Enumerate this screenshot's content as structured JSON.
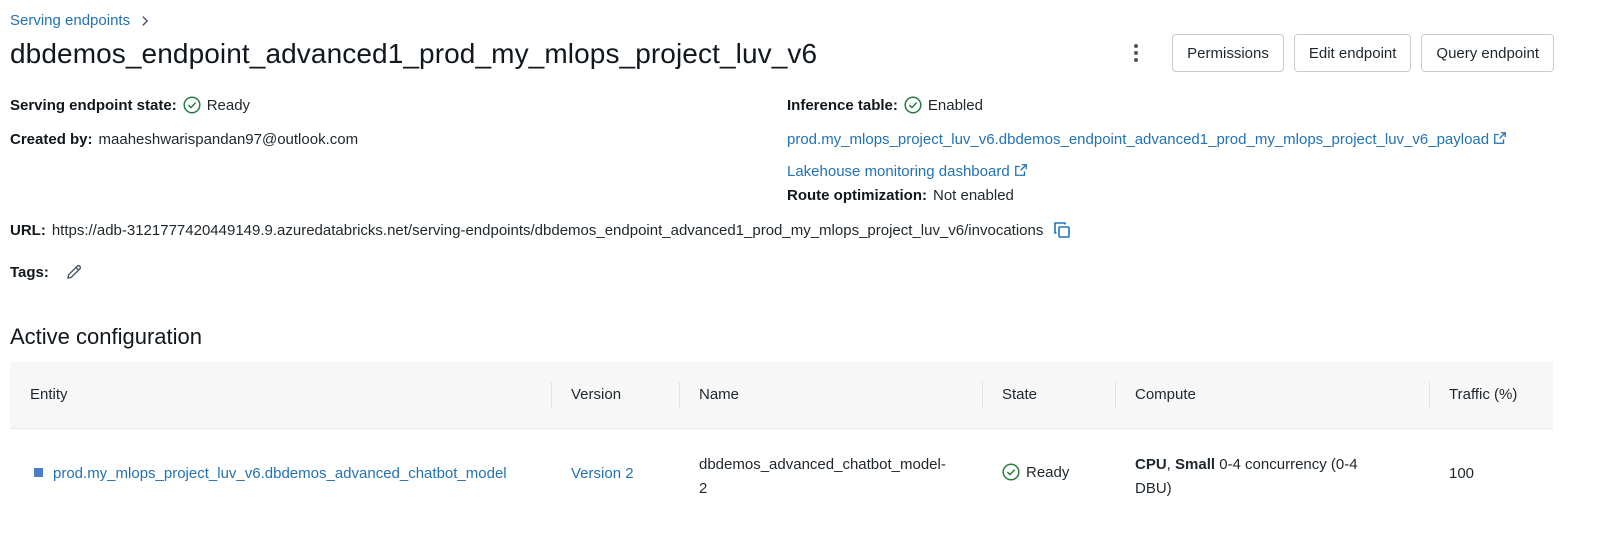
{
  "breadcrumb": {
    "label": "Serving endpoints"
  },
  "header": {
    "title": "dbdemos_endpoint_advanced1_prod_my_mlops_project_luv_v6",
    "buttons": {
      "permissions": "Permissions",
      "edit": "Edit endpoint",
      "query": "Query endpoint"
    }
  },
  "details": {
    "state_label": "Serving endpoint state:",
    "state_value": "Ready",
    "created_label": "Created by:",
    "created_value": "maaheshwarispandan97@outlook.com",
    "inference_label": "Inference table:",
    "inference_value": "Enabled",
    "payload_link": "prod.my_mlops_project_luv_v6.dbdemos_endpoint_advanced1_prod_my_mlops_project_luv_v6_payload",
    "monitor_link": "Lakehouse monitoring dashboard",
    "route_label": "Route optimization:",
    "route_value": "Not enabled",
    "url_label": "URL:",
    "url_value": "https://adb-3121777420449149.9.azuredatabricks.net/serving-endpoints/dbdemos_endpoint_advanced1_prod_my_mlops_project_luv_v6/invocations",
    "tags_label": "Tags:"
  },
  "config": {
    "title": "Active configuration",
    "columns": {
      "entity": "Entity",
      "version": "Version",
      "name": "Name",
      "state": "State",
      "compute": "Compute",
      "traffic": "Traffic (%)"
    },
    "rows": [
      {
        "entity": "prod.my_mlops_project_luv_v6.dbdemos_advanced_chatbot_model",
        "version": "Version 2",
        "name_line1": "dbdemos_advanced_chatbot_model-",
        "name_line2": "2",
        "state": "Ready",
        "compute_cpu": "CPU",
        "compute_sep": ", ",
        "compute_size": "Small",
        "compute_rest_line1": " 0-4 concurrency (0-4",
        "compute_rest_line2": "DBU)",
        "traffic": "100"
      }
    ]
  },
  "colors": {
    "link": "#2272b4",
    "success": "#277c43",
    "entity_marker": "#4a7ec7"
  },
  "icons": [
    "chevron-right-icon",
    "kebab-menu-icon",
    "check-circle-icon",
    "external-link-icon",
    "copy-icon",
    "pencil-icon",
    "entity-square-icon"
  ]
}
